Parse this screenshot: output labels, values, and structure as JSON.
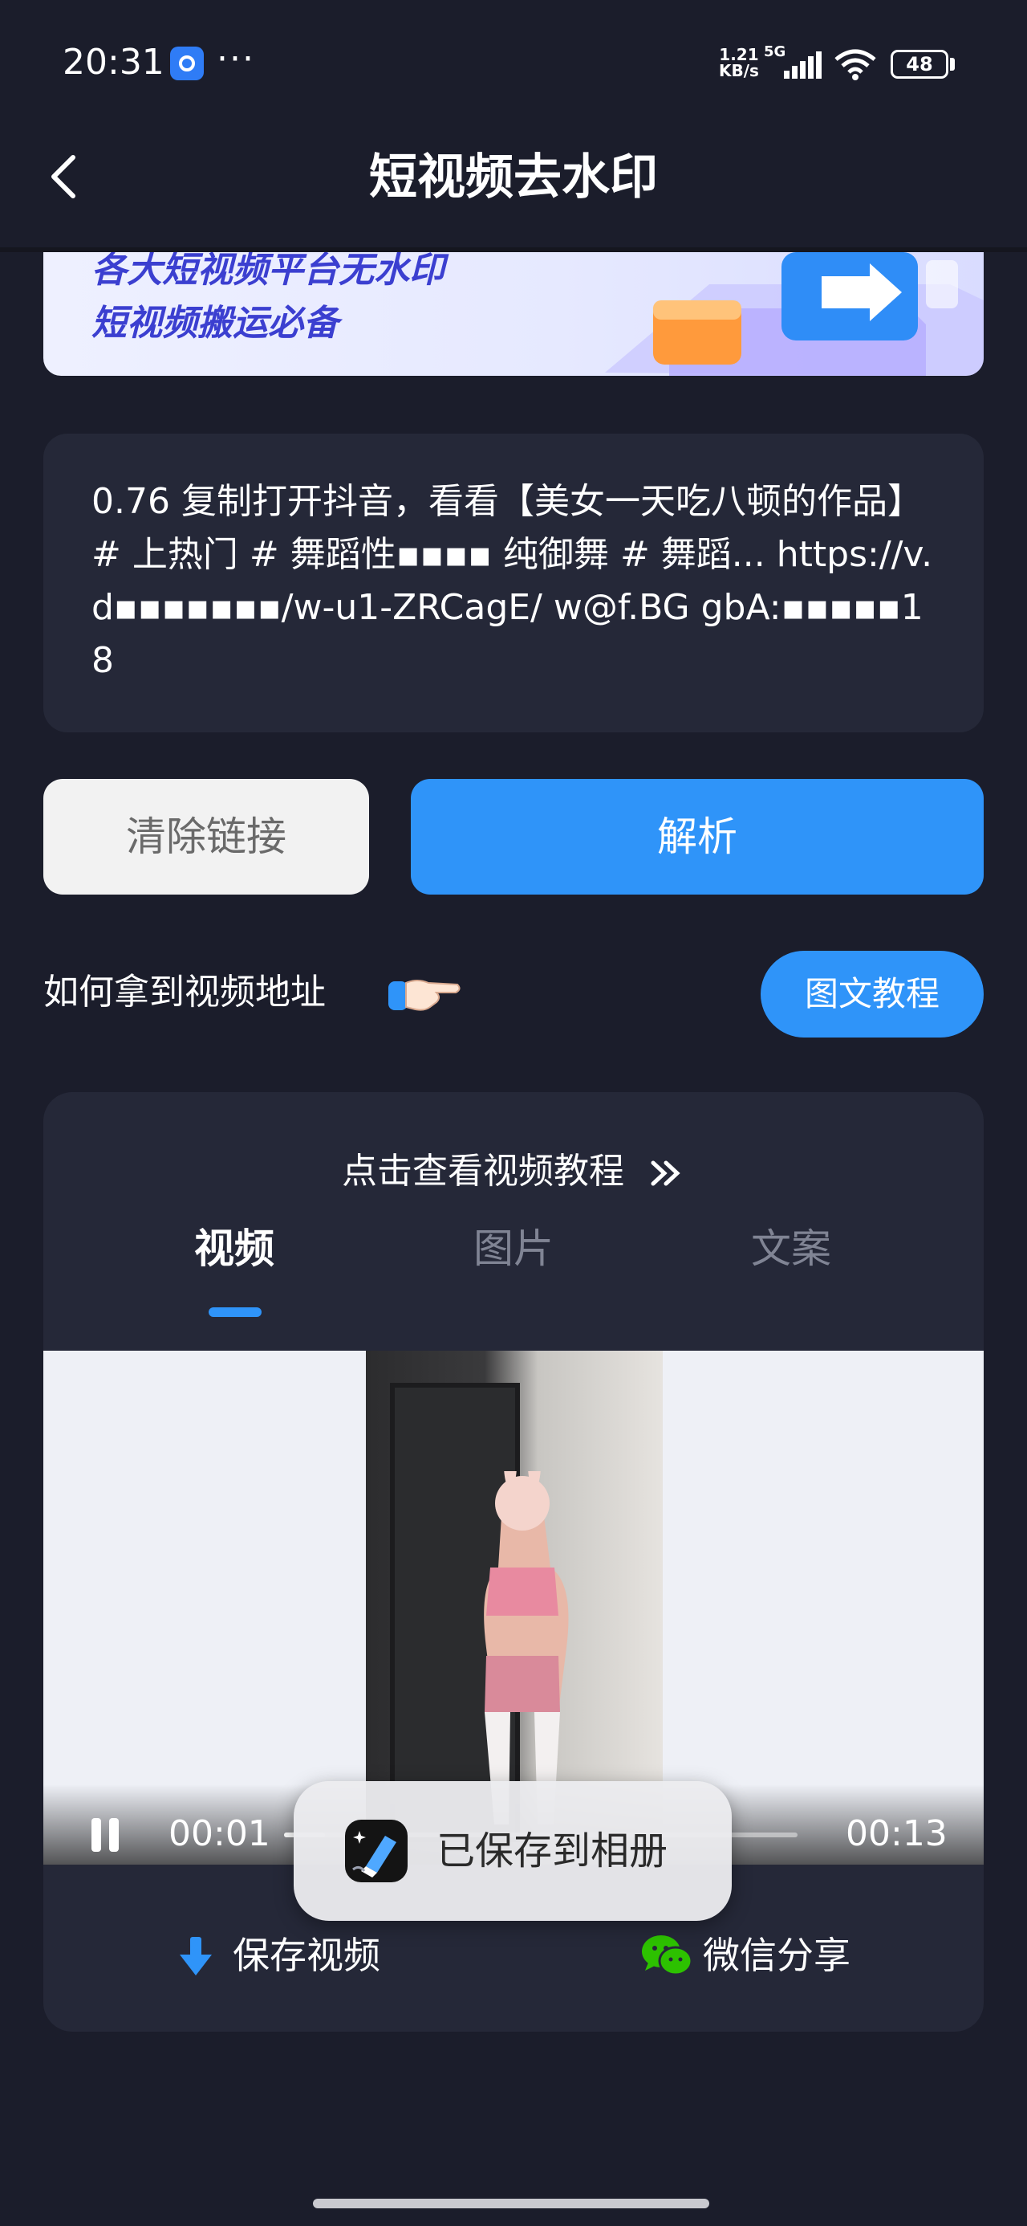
{
  "status_bar": {
    "time": "20:31",
    "more": "···",
    "net_speed_value": "1.21",
    "net_speed_unit": "KB/s",
    "network": "5G",
    "battery": "48"
  },
  "header": {
    "title": "短视频去水印"
  },
  "banner": {
    "line1": "各大短视频平台无水印",
    "line2": "短视频搬运必备"
  },
  "link_input": {
    "value": "0.76 复制打开抖音，看看【美女一天吃八顿的作品】# 上热门 # 舞蹈性▪▪▪▪ 纯御舞 # 舞蹈... https://v.d▪▪▪▪▪▪▪/w-u1-ZRCagE/ w@f.BG gbA:▪▪▪▪▪18"
  },
  "actions": {
    "clear_label": "清除链接",
    "parse_label": "解析"
  },
  "howto": {
    "label": "如何拿到视频地址",
    "tutorial_button": "图文教程"
  },
  "result": {
    "video_tutorial_link": "点击查看视频教程",
    "tabs": [
      {
        "label": "视频",
        "active": true
      },
      {
        "label": "图片",
        "active": false
      },
      {
        "label": "文案",
        "active": false
      }
    ],
    "player": {
      "current_time": "00:01",
      "total_time": "00:13",
      "progress": 0.08
    },
    "save_label": "保存视频",
    "share_label": "微信分享"
  },
  "toast": {
    "message": "已保存到相册"
  },
  "colors": {
    "background": "#1b1d2b",
    "card": "#252838",
    "accent": "#2f94f9",
    "wechat": "#2dc100"
  }
}
